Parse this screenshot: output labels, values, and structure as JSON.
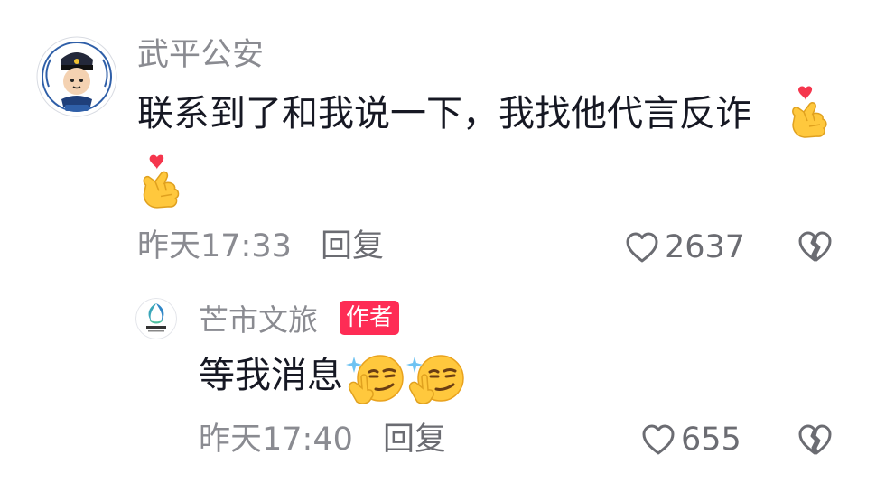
{
  "comment": {
    "username": "武平公安",
    "text": "联系到了和我说一下，我找他代言反诈",
    "emojis": [
      "finger-heart-emoji",
      "finger-heart-emoji"
    ],
    "time": "昨天17:33",
    "reply_label": "回复",
    "like_count": "2637",
    "avatar_icon": "police-avatar-icon"
  },
  "reply": {
    "username": "芒市文旅",
    "badge": "作者",
    "text": "等我消息",
    "emojis": [
      "smirk-sparkle-emoji",
      "smirk-sparkle-emoji"
    ],
    "time": "昨天17:40",
    "reply_label": "回复",
    "like_count": "655",
    "avatar_icon": "mangshi-tourism-logo-icon"
  },
  "colors": {
    "text": "#161823",
    "secondary": "#8a8b91",
    "badge_bg": "#fe2c55",
    "badge_text": "#ffffff"
  }
}
